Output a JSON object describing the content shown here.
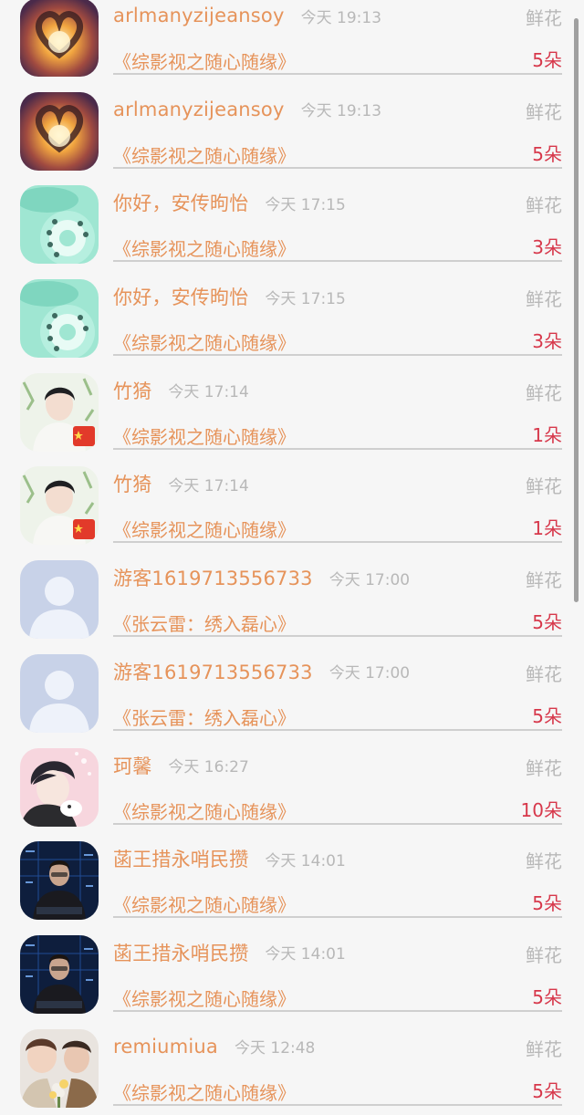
{
  "items": [
    {
      "avatar": "heart-hands-avatar",
      "name": "arlmanyzijeansoy",
      "time": "今天 19:13",
      "kind": "鲜花",
      "work": "《综影视之随心随缘》",
      "amount": "5朵"
    },
    {
      "avatar": "heart-hands-avatar",
      "name": "arlmanyzijeansoy",
      "time": "今天 19:13",
      "kind": "鲜花",
      "work": "《综影视之随心随缘》",
      "amount": "5朵"
    },
    {
      "avatar": "mint-telephone-avatar",
      "name": "你好，安传昫怡",
      "time": "今天 17:15",
      "kind": "鲜花",
      "work": "《综影视之随心随缘》",
      "amount": "3朵"
    },
    {
      "avatar": "mint-telephone-avatar",
      "name": "你好，安传昫怡",
      "time": "今天 17:15",
      "kind": "鲜花",
      "work": "《综影视之随心随缘》",
      "amount": "3朵"
    },
    {
      "avatar": "man-portrait-flag-avatar",
      "name": "竹猗",
      "time": "今天 17:14",
      "kind": "鲜花",
      "work": "《综影视之随心随缘》",
      "amount": "1朵"
    },
    {
      "avatar": "man-portrait-flag-avatar",
      "name": "竹猗",
      "time": "今天 17:14",
      "kind": "鲜花",
      "work": "《综影视之随心随缘》",
      "amount": "1朵"
    },
    {
      "avatar": "default-user-avatar",
      "name": "游客1619713556733",
      "time": "今天 17:00",
      "kind": "鲜花",
      "work": "《张云雷：绣入磊心》",
      "amount": "5朵"
    },
    {
      "avatar": "default-user-avatar",
      "name": "游客1619713556733",
      "time": "今天 17:00",
      "kind": "鲜花",
      "work": "《张云雷：绣入磊心》",
      "amount": "5朵"
    },
    {
      "avatar": "anime-boy-avatar",
      "name": "珂馨",
      "time": "今天 16:27",
      "kind": "鲜花",
      "work": "《综影视之随心随缘》",
      "amount": "10朵"
    },
    {
      "avatar": "hacker-screen-avatar",
      "name": "菡王措永哨民攒",
      "time": "今天 14:01",
      "kind": "鲜花",
      "work": "《综影视之随心随缘》",
      "amount": "5朵"
    },
    {
      "avatar": "hacker-screen-avatar",
      "name": "菡王措永哨民攒",
      "time": "今天 14:01",
      "kind": "鲜花",
      "work": "《综影视之随心随缘》",
      "amount": "5朵"
    },
    {
      "avatar": "couple-flowers-avatar",
      "name": "remiumiua",
      "time": "今天 12:48",
      "kind": "鲜花",
      "work": "《综影视之随心随缘》",
      "amount": "5朵"
    }
  ]
}
